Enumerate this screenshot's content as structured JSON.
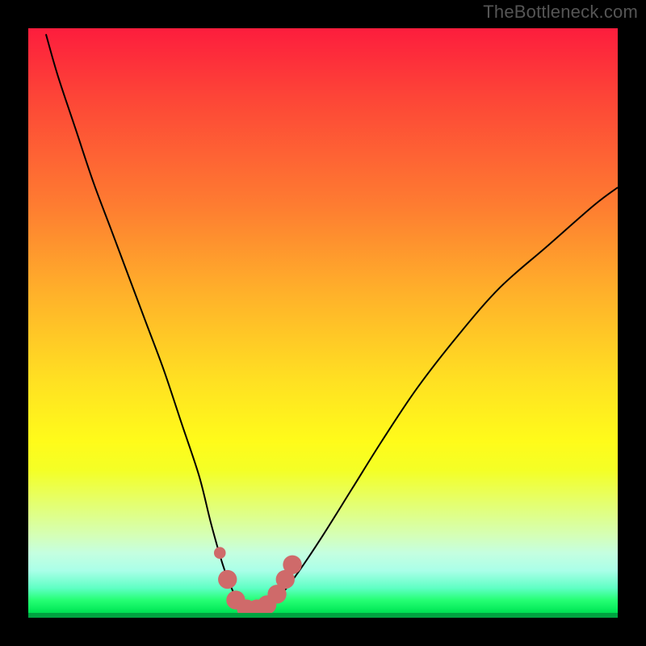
{
  "watermark": "TheBottleneck.com",
  "colors": {
    "background": "#000000",
    "curve_stroke": "#000000",
    "marker_stroke": "#cf6a6a",
    "marker_fill": "#cf6a6a"
  },
  "chart_data": {
    "type": "line",
    "title": "",
    "xlabel": "",
    "ylabel": "",
    "xlim": [
      0,
      100
    ],
    "ylim": [
      0,
      100
    ],
    "series": [
      {
        "name": "bottleneck-curve",
        "x": [
          3,
          5,
          8,
          11,
          14,
          17,
          20,
          23,
          26,
          29,
          31,
          33,
          34.5,
          36,
          37.5,
          39,
          41,
          43,
          46,
          50,
          55,
          60,
          66,
          73,
          80,
          88,
          96,
          100
        ],
        "y": [
          99,
          92,
          83,
          74,
          66,
          58,
          50,
          42,
          33,
          24,
          16,
          9,
          5,
          2,
          1,
          1,
          2,
          4,
          8,
          14,
          22,
          30,
          39,
          48,
          56,
          63,
          70,
          73
        ]
      }
    ],
    "markers": [
      {
        "x": 32.5,
        "y": 11
      },
      {
        "x": 33.8,
        "y": 6.5
      },
      {
        "x": 35.2,
        "y": 3
      },
      {
        "x": 37,
        "y": 1.5
      },
      {
        "x": 38.8,
        "y": 1.5
      },
      {
        "x": 40.5,
        "y": 2.2
      },
      {
        "x": 42.2,
        "y": 4
      },
      {
        "x": 43.6,
        "y": 6.5
      },
      {
        "x": 44.8,
        "y": 9
      }
    ]
  }
}
